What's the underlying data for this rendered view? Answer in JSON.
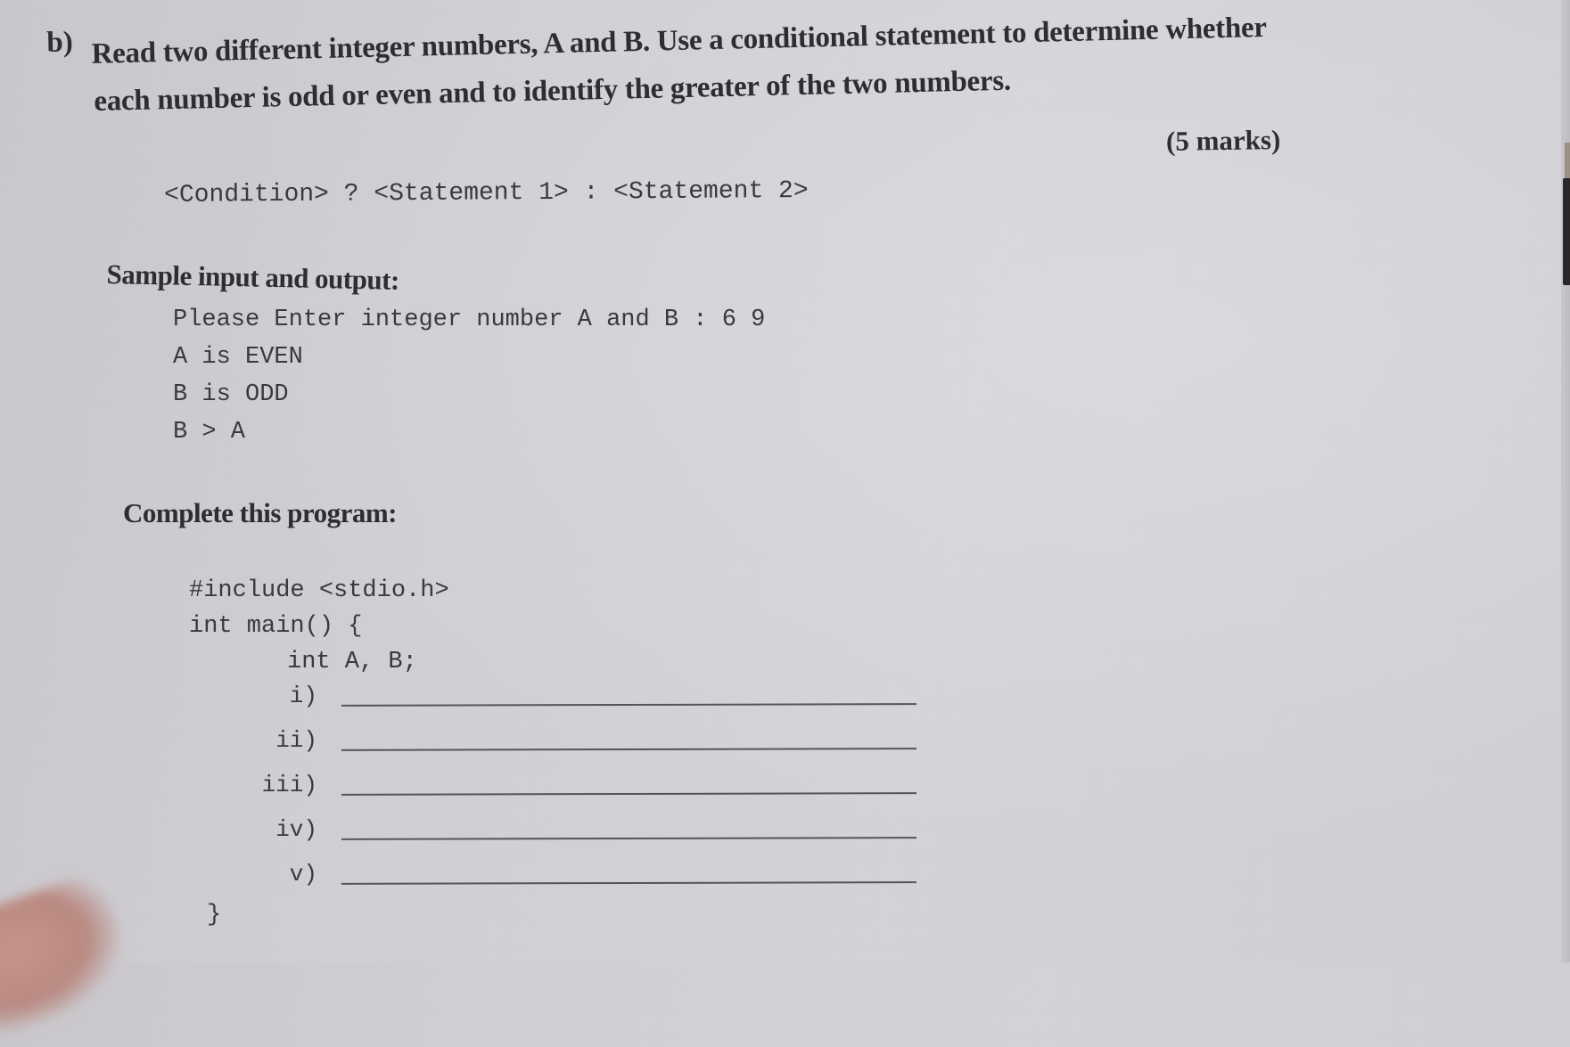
{
  "question": {
    "label": "b)",
    "text_line1": "Read two different integer numbers, A and B. Use a conditional statement to determine whether",
    "text_line2": "each number is odd or even and to identify the greater of the two numbers.",
    "marks": "(5 marks)"
  },
  "syntax_hint": "<Condition> ? <Statement 1> : <Statement 2>",
  "sample": {
    "title": "Sample input and output:",
    "lines": [
      "Please Enter integer number A and B : 6 9",
      "A is EVEN",
      "B is ODD",
      "B > A"
    ]
  },
  "program": {
    "title": "Complete this program:",
    "code_lines": [
      "#include <stdio.h>",
      "int main() {",
      "int A, B;"
    ],
    "blanks": [
      {
        "label": "i)",
        "value": ""
      },
      {
        "label": "ii)",
        "value": ""
      },
      {
        "label": "iii)",
        "value": ""
      },
      {
        "label": "iv)",
        "value": ""
      },
      {
        "label": "v)",
        "value": ""
      }
    ],
    "closing": "}"
  }
}
